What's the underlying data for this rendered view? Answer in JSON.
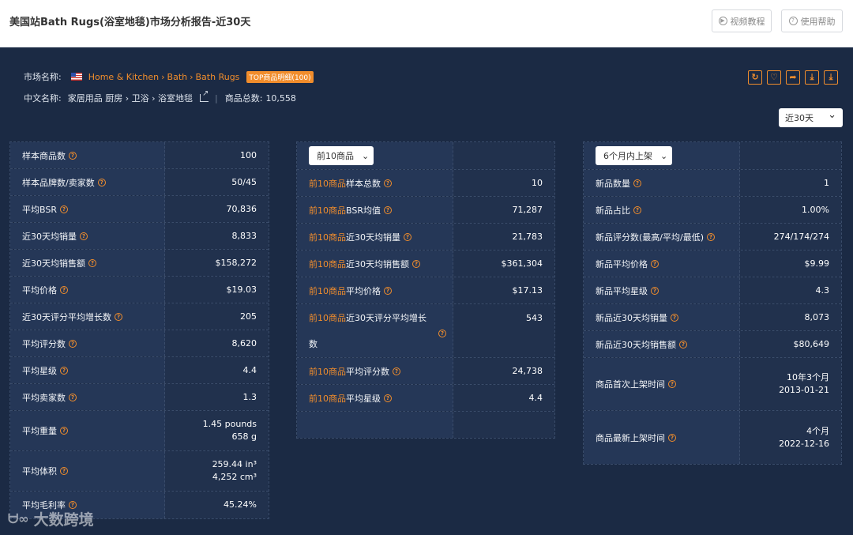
{
  "header": {
    "title": "美国站Bath Rugs(浴室地毯)市场分析报告-近30天",
    "video_btn": "视频教程",
    "help_btn": "使用帮助"
  },
  "meta": {
    "market_label": "市场名称:",
    "crumbs": [
      "Home & Kitchen",
      "Bath",
      "Bath Rugs"
    ],
    "top_badge": "TOP商品明细(100)",
    "cn_label": "中文名称:",
    "cn_crumbs": "家居用品 厨房 › 卫浴 › 浴室地毯",
    "total_label": "商品总数:",
    "total_value": "10,558",
    "period": "近30天"
  },
  "panel1": {
    "rows": [
      {
        "label": "样本商品数",
        "value": "100"
      },
      {
        "label": "样本品牌数/卖家数",
        "value": "50/45"
      },
      {
        "label": "平均BSR",
        "value": "70,836"
      },
      {
        "label": "近30天均销量",
        "value": "8,833"
      },
      {
        "label": "近30天均销售额",
        "value": "$158,272"
      },
      {
        "label": "平均价格",
        "value": "$19.03"
      },
      {
        "label": "近30天评分平均增长数",
        "value": "205"
      },
      {
        "label": "平均评分数",
        "value": "8,620"
      },
      {
        "label": "平均星级",
        "value": "4.4"
      },
      {
        "label": "平均卖家数",
        "value": "1.3"
      },
      {
        "label": "平均重量",
        "value": "1.45 pounds",
        "value2": "658 g"
      },
      {
        "label": "平均体积",
        "value": "259.44 in³",
        "value2": "4,252 cm³"
      },
      {
        "label": "平均毛利率",
        "value": "45.24%"
      }
    ]
  },
  "panel2": {
    "select": "前10商品",
    "prefix": "前10商品",
    "rows": [
      {
        "label": "样本总数",
        "value": "10"
      },
      {
        "label": "BSR均值",
        "value": "71,287"
      },
      {
        "label": "近30天均销量",
        "value": "21,783"
      },
      {
        "label": "近30天均销售额",
        "value": "$361,304"
      },
      {
        "label": "平均价格",
        "value": "$17.13"
      },
      {
        "label": "近30天评分平均增长",
        "label2": "数",
        "value": "543"
      },
      {
        "label": "平均评分数",
        "value": "24,738"
      },
      {
        "label": "平均星级",
        "value": "4.4"
      }
    ]
  },
  "panel3": {
    "select": "6个月内上架",
    "rows": [
      {
        "label": "新品数量",
        "value": "1"
      },
      {
        "label": "新品占比",
        "value": "1.00%"
      },
      {
        "label": "新品评分数(最高/平均/最低)",
        "value": "274/174/274"
      },
      {
        "label": "新品平均价格",
        "value": "$9.99"
      },
      {
        "label": "新品平均星级",
        "value": "4.3"
      },
      {
        "label": "新品近30天均销量",
        "value": "8,073"
      },
      {
        "label": "新品近30天均销售额",
        "value": "$80,649"
      },
      {
        "label": "商品首次上架时间",
        "value": "10年3个月",
        "value2": "2013-01-21"
      },
      {
        "label": "商品最新上架时间",
        "value": "4个月",
        "value2": "2022-12-16"
      }
    ]
  },
  "watermark": "大数跨境",
  "colors": {
    "accent": "#f18d2c",
    "bg": "#1b2a44",
    "label_bg": "#253757",
    "value_bg": "#21314d"
  }
}
